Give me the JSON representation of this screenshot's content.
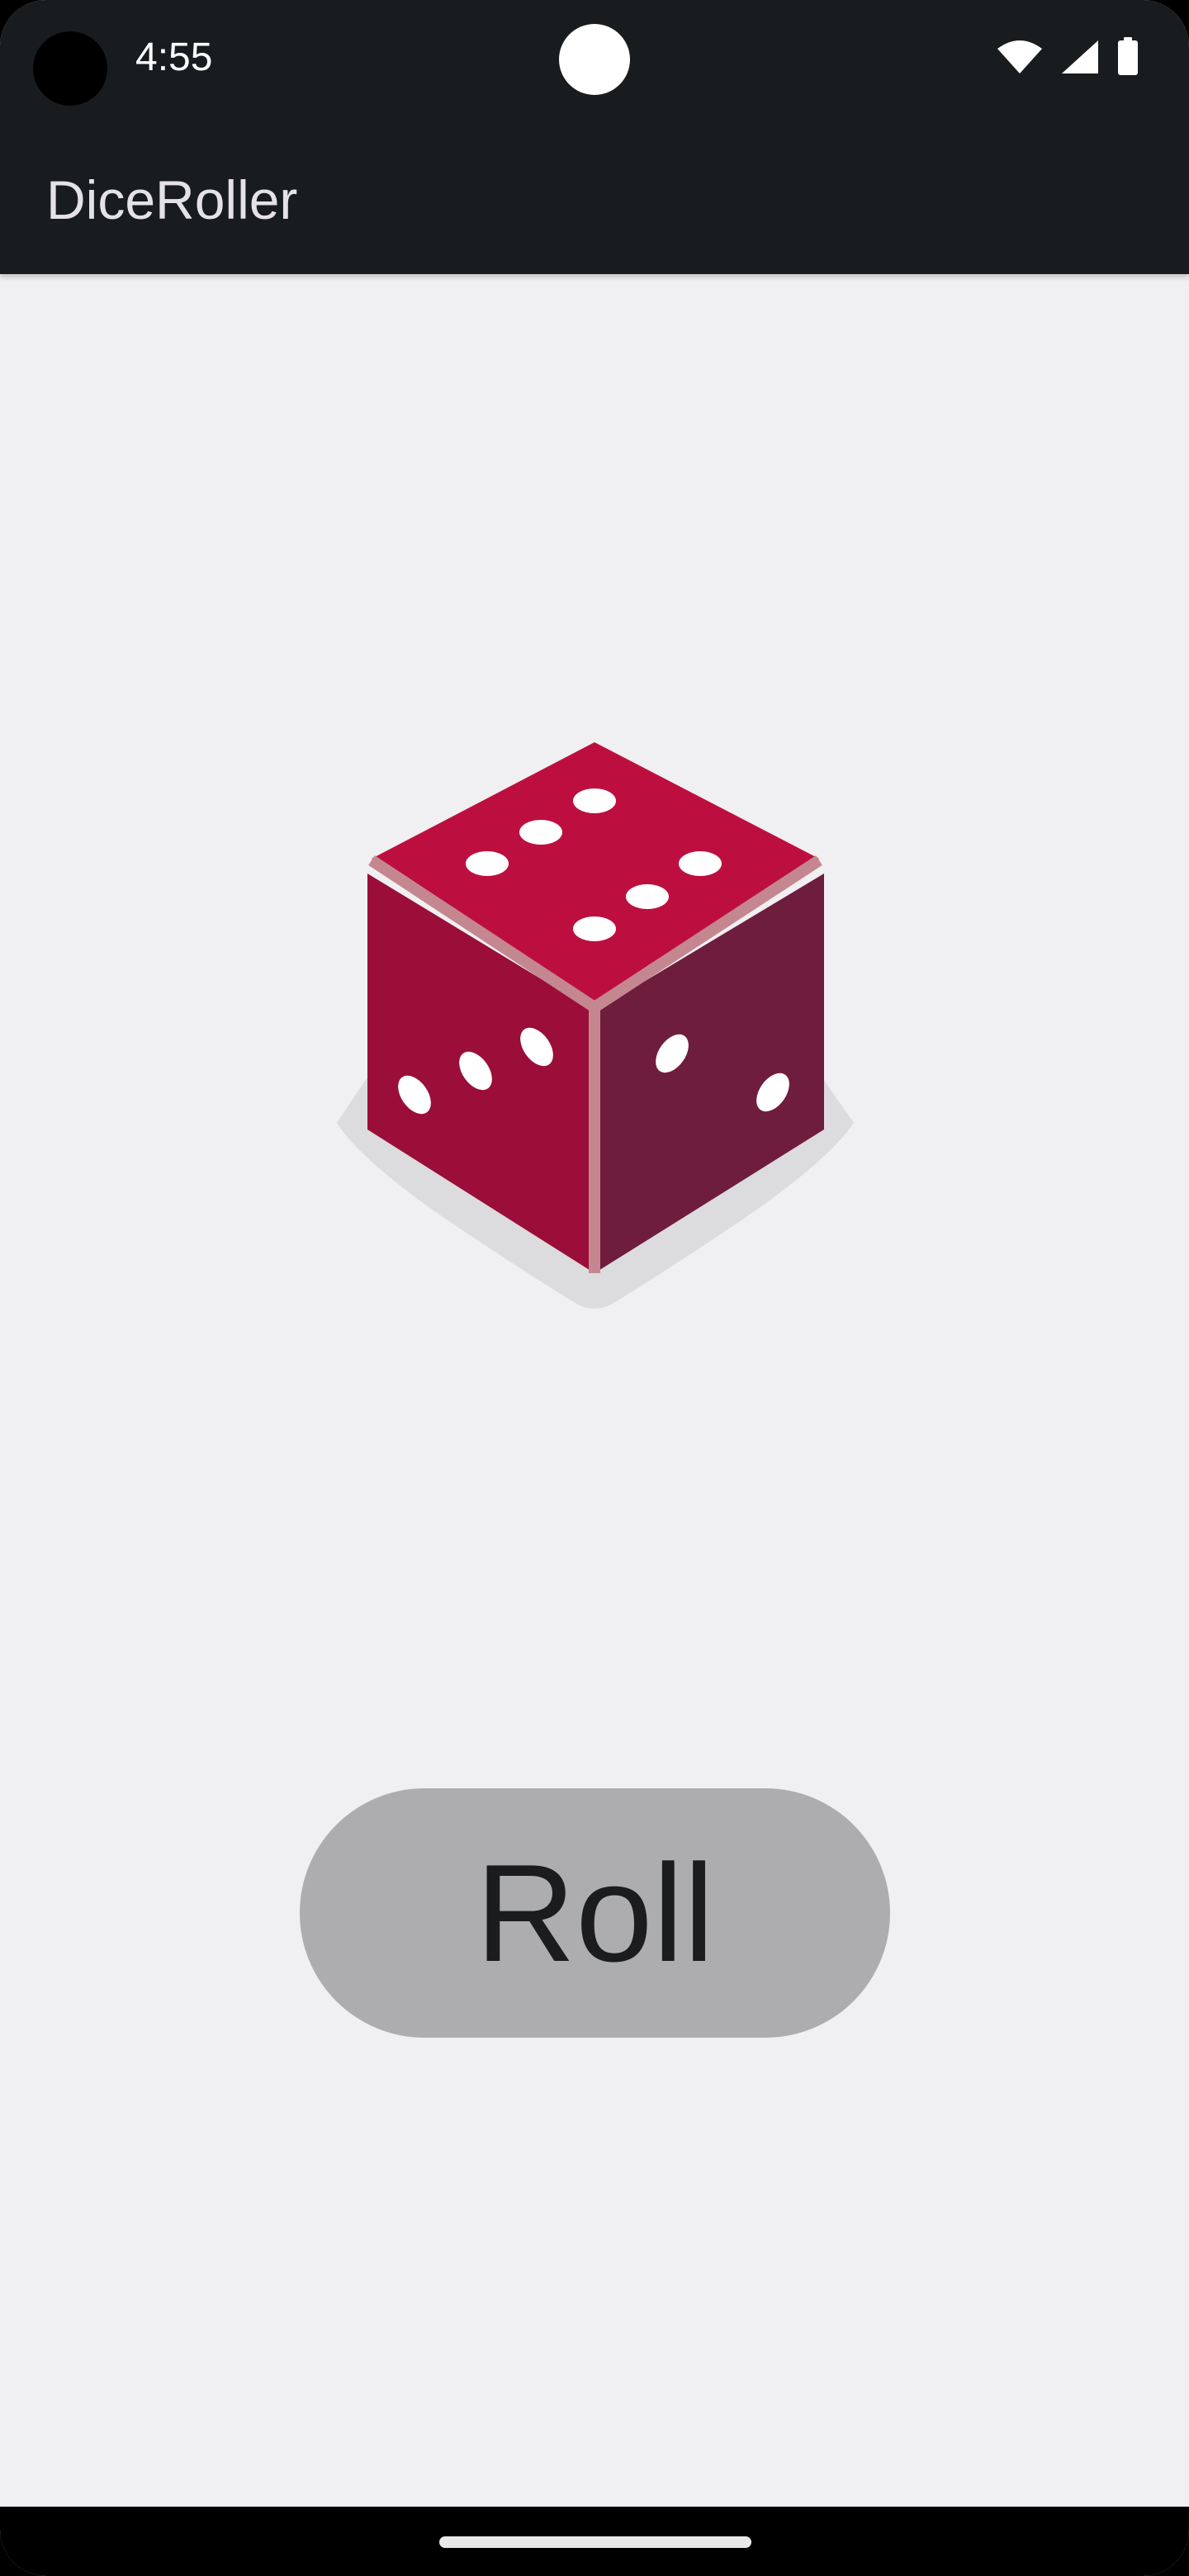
{
  "status_bar": {
    "time": "4:55",
    "icons": [
      "wifi-icon",
      "cell-signal-icon",
      "battery-icon"
    ]
  },
  "app_bar": {
    "title": "DiceRoller"
  },
  "dice": {
    "icon": "dice-icon",
    "colors": {
      "top": "#bd0f3f",
      "left": "#9a0e39",
      "right": "#6e1d3d",
      "edge": "#c48790",
      "pip": "#ffffff",
      "shadow": "#dcdbdd"
    }
  },
  "roll_button": {
    "label": "Roll"
  },
  "colors": {
    "app_bar_bg": "#191c1f",
    "screen_bg": "#f0eff2",
    "button_bg": "#adadaf"
  }
}
